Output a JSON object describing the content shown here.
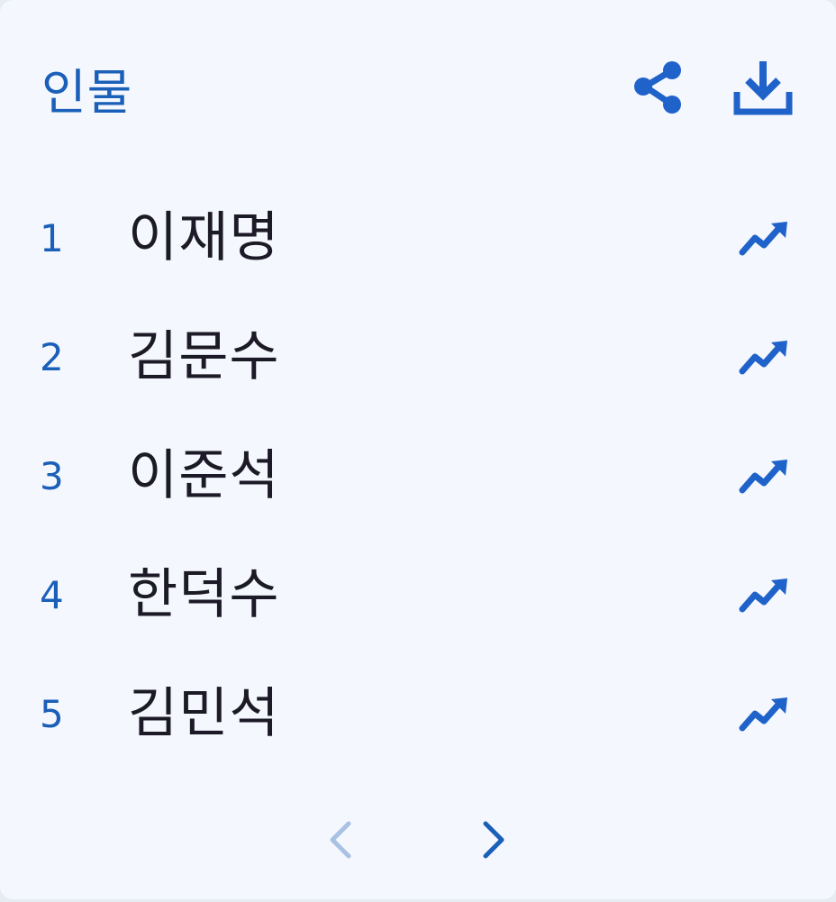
{
  "header": {
    "title": "인물",
    "icons": [
      "share-icon",
      "download-icon"
    ]
  },
  "ranking": {
    "items": [
      {
        "rank": "1",
        "name": "이재명",
        "trend_icon": "trending-up-icon"
      },
      {
        "rank": "2",
        "name": "김문수",
        "trend_icon": "trending-up-icon"
      },
      {
        "rank": "3",
        "name": "이준석",
        "trend_icon": "trending-up-icon"
      },
      {
        "rank": "4",
        "name": "한덕수",
        "trend_icon": "trending-up-icon"
      },
      {
        "rank": "5",
        "name": "김민석",
        "trend_icon": "trending-up-icon"
      }
    ]
  },
  "pagination": {
    "prev_icon": "chevron-left-icon",
    "next_icon": "chevron-right-icon"
  },
  "colors": {
    "accent": "#1a5fb8",
    "icon_blue": "#1f62c9",
    "text": "#1c1a26",
    "background": "#f4f7fd",
    "disabled": "#a9c2e4"
  }
}
